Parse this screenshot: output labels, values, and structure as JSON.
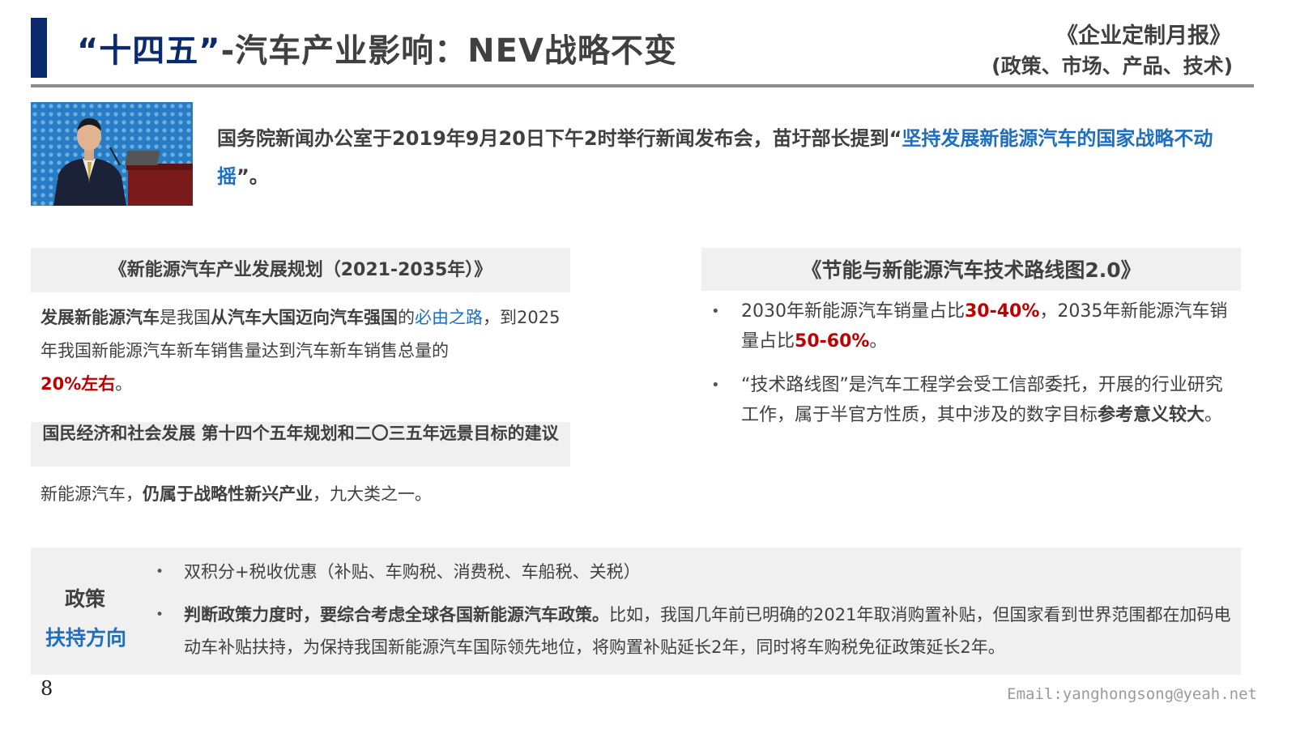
{
  "header": {
    "title_quote": "“十四五”",
    "title_rest": "-汽车产业影响：NEV战略不变",
    "report_name": "《企业定制月报》",
    "report_sub": "(政策、市场、产品、技术)"
  },
  "intro": {
    "text": "国务院新闻办公室于2019年9月20日下午2时举行新闻发布会，苗圩部长提到“",
    "highlight": "坚持发展新能源汽车的国家战略不动摇",
    "tail": "”。"
  },
  "left_box1": {
    "heading": "《新能源汽车产业发展规划（2021-2035年）》",
    "p1": "发展新能源汽车",
    "p2": "是我国",
    "p3": "从汽车大国迈向汽车强国",
    "p4": "的",
    "p5": "必由之路",
    "p6": "，到2025年我国新能源汽车新车销售量达到汽车新车销售总量的",
    "p7": "20%左右",
    "p8": "。"
  },
  "left_box2": {
    "heading": "国民经济和社会发展 第十四个五年规划和二〇三五年远景目标的建议",
    "p1": "新能源汽车，",
    "p2": "仍属于战略性新兴产业",
    "p3": "，九大类之一。"
  },
  "right_box": {
    "heading": "《节能与新能源汽车技术路线图2.0》",
    "bullet": "•",
    "item1_a": "2030年新能源汽车销量占比",
    "item1_b": "30-40%",
    "item1_c": "，2035年新能源汽车销量占比",
    "item1_d": "50-60%",
    "item1_e": "。",
    "item2_a": "“技术路线图”是汽车工程学会受工信部委托，开展的行业研究工作，属于半官方性质，其中涉及的数字目标",
    "item2_b": "参考意义较大",
    "item2_c": "。"
  },
  "policy": {
    "label1": "政策",
    "label2": "扶持方向",
    "bullet": "•",
    "item1": "双积分+税收优惠（补贴、车购税、消费税、车船税、关税）",
    "item2_bold": "判断政策力度时，要综合考虑全球各国新能源汽车政策。",
    "item2_rest": "比如，我国几年前已明确的2021年取消购置补贴，但国家看到世界范围都在加码电动车补贴扶持，为保持我国新能源汽车国际领先地位，将购置补贴延长2年，同时将车购税免征政策延长2年。"
  },
  "footer": {
    "page_number": "8",
    "email": "Email:yanghongsong@yeah.net"
  },
  "colors": {
    "accent": "#0b2a6e",
    "highlight_blue": "#1f6fc0",
    "highlight_red": "#c00000",
    "panel_gray": "#f0f0f0"
  }
}
